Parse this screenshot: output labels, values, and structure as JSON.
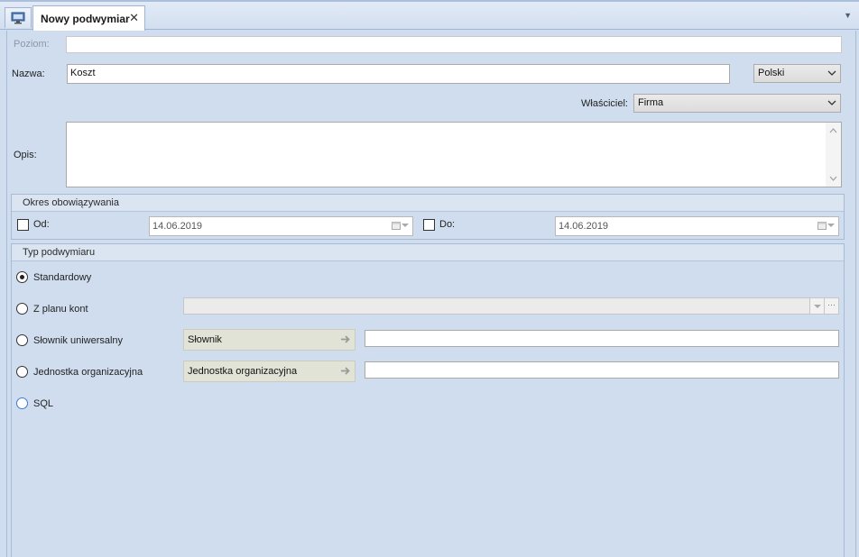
{
  "tabs": {
    "home_icon": "monitor-icon",
    "active_label": "Nowy podwymiar",
    "close_glyph": "✕"
  },
  "form": {
    "poziom_label": "Poziom:",
    "poziom_value": "",
    "nazwa_label": "Nazwa:",
    "nazwa_value": "Koszt",
    "language_value": "Polski",
    "wlasciciel_label": "Właściciel:",
    "wlasciciel_value": "Firma",
    "opis_label": "Opis:",
    "opis_value": ""
  },
  "okres": {
    "title": "Okres obowiązywania",
    "od_label": "Od:",
    "od_value": "14.06.2019",
    "od_checked": false,
    "do_label": "Do:",
    "do_value": "14.06.2019",
    "do_checked": false
  },
  "typ": {
    "title": "Typ podwymiaru",
    "selected": "standardowy",
    "options": {
      "standardowy": "Standardowy",
      "z_planu_kont": "Z planu kont",
      "slownik": "Słownik uniwersalny",
      "jednostka": "Jednostka organizacyjna",
      "sql": "SQL"
    },
    "slownik_button": "Słownik",
    "slownik_value": "",
    "jednostka_button": "Jednostka organizacyjna",
    "jednostka_value": "",
    "plan_kont_value": "",
    "plan_kont_more": "···"
  },
  "colors": {
    "background": "#cfddef",
    "group_header": "#dbe5f2",
    "border": "#a7bbd6"
  }
}
